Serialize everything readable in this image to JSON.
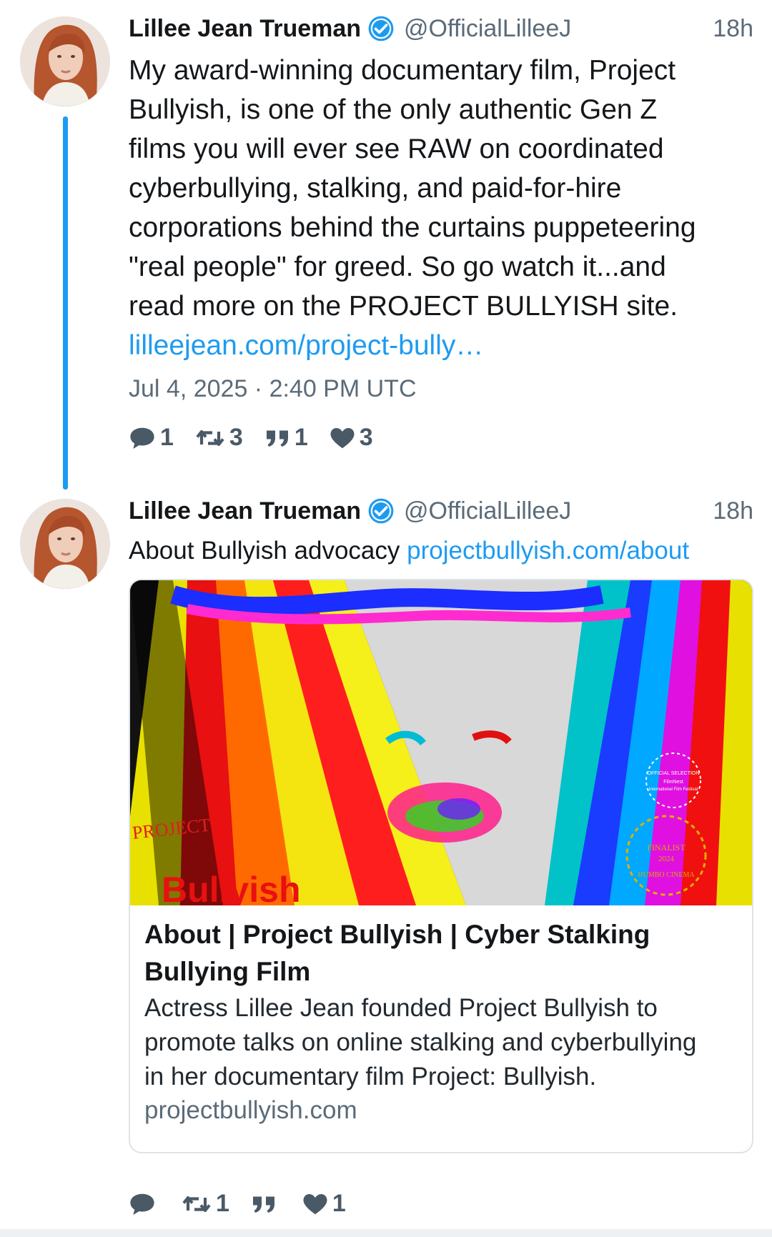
{
  "tweets": [
    {
      "fullname": "Lillee Jean Trueman",
      "username": "@OfficialLilleeJ",
      "time": "18h",
      "text_lines": [
        "My award-winning documentary film, Project",
        "Bullyish, is one of the only authentic Gen Z",
        "films you will ever see RAW on coordinated",
        "cyberbullying, stalking, and paid-for-hire",
        "corporations behind the curtains puppeteering",
        "\"real people\" for greed. So go watch it...and",
        "read more on the PROJECT BULLYISH site."
      ],
      "link_text": "lilleejean.com/project-bully…",
      "date": "Jul 4, 2025 · 2:40 PM UTC",
      "stats": {
        "replies": "1",
        "retweets": "3",
        "quotes": "1",
        "likes": "3"
      }
    },
    {
      "fullname": "Lillee Jean Trueman",
      "username": "@OfficialLilleeJ",
      "time": "18h",
      "text": "About Bullyish advocacy",
      "link_text": "projectbullyish.com/about",
      "card": {
        "image_text_top": "PROJECT",
        "image_text_bottom": "Bullyish",
        "laurel_top_text": "OFFICIAL SELECTION FilmNest International Film Festival 2024",
        "laurel_bottom_text": "FINALIST 2024 HUMBO CINEMA",
        "title_lines": [
          "About | Project Bullyish | Cyber Stalking",
          "Bullying Film"
        ],
        "desc_lines": [
          "Actress Lillee Jean founded Project Bullyish to",
          "promote talks on online stalking and cyberbullying",
          "in her documentary film Project: Bullyish."
        ],
        "domain": "projectbullyish.com"
      },
      "stats": {
        "replies": "",
        "retweets": "1",
        "quotes": "",
        "likes": "1"
      }
    }
  ],
  "colors": {
    "accent": "#1d9bf0",
    "muted": "#5b6b78",
    "text": "#14171a"
  },
  "icons": [
    "verified-badge-icon",
    "reply-icon",
    "retweet-icon",
    "quote-icon",
    "heart-icon"
  ]
}
